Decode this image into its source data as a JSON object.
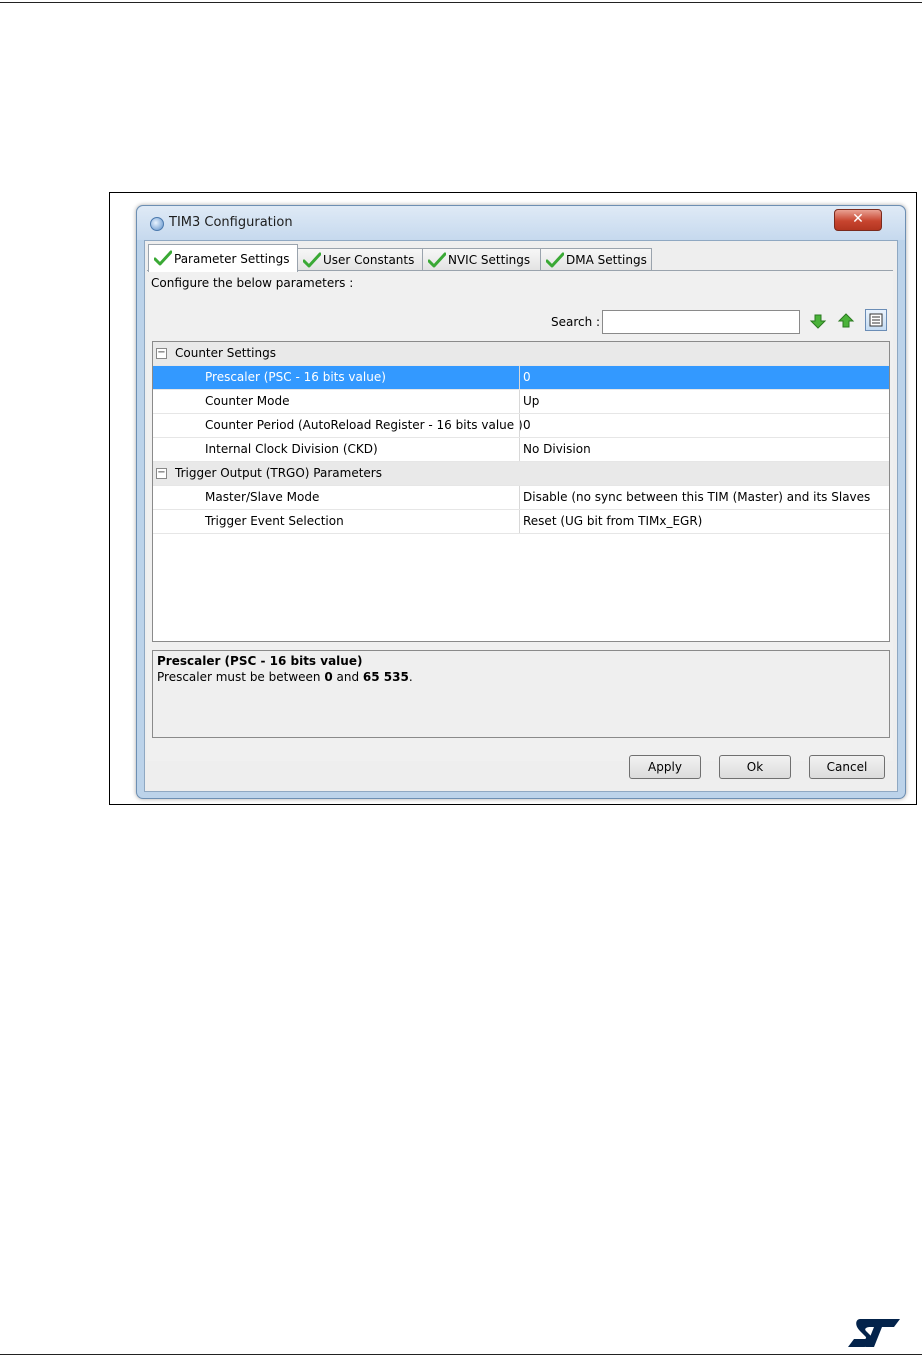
{
  "window": {
    "title": "TIM3 Configuration",
    "close_glyph": "✕"
  },
  "tabs": [
    {
      "label": "Parameter Settings",
      "active": true,
      "icon": "check-icon"
    },
    {
      "label": "User Constants",
      "active": false,
      "icon": "check-icon"
    },
    {
      "label": "NVIC Settings",
      "active": false,
      "icon": "check-icon"
    },
    {
      "label": "DMA Settings",
      "active": false,
      "icon": "check-icon"
    }
  ],
  "panel": {
    "hint": "Configure the below parameters :",
    "search": {
      "label": "Search :",
      "value": "",
      "placeholder": ""
    }
  },
  "tree": {
    "groups": [
      {
        "label": "Counter Settings",
        "rows": [
          {
            "name": "Prescaler (PSC - 16 bits value)",
            "value": "0",
            "selected": true
          },
          {
            "name": "Counter Mode",
            "value": "Up"
          },
          {
            "name": "Counter Period (AutoReload Register - 16 bits value )",
            "value": "0"
          },
          {
            "name": "Internal Clock Division (CKD)",
            "value": "No Division"
          }
        ]
      },
      {
        "label": "Trigger Output (TRGO) Parameters",
        "rows": [
          {
            "name": "Master/Slave Mode",
            "value": "Disable (no sync between this TIM (Master) and its Slaves"
          },
          {
            "name": "Trigger Event Selection",
            "value": "Reset (UG bit from TIMx_EGR)"
          }
        ]
      }
    ]
  },
  "description": {
    "title": "Prescaler (PSC - 16 bits value)",
    "text_prefix": "Prescaler must be between ",
    "min": "0",
    "text_middle": " and ",
    "max": "65 535",
    "text_suffix": "."
  },
  "buttons": {
    "apply": "Apply",
    "ok": "Ok",
    "cancel": "Cancel"
  },
  "colors": {
    "selection": "#3399ff",
    "check_green": "#3aa935",
    "close_red": "#c7452f",
    "brand": "#03234b"
  }
}
